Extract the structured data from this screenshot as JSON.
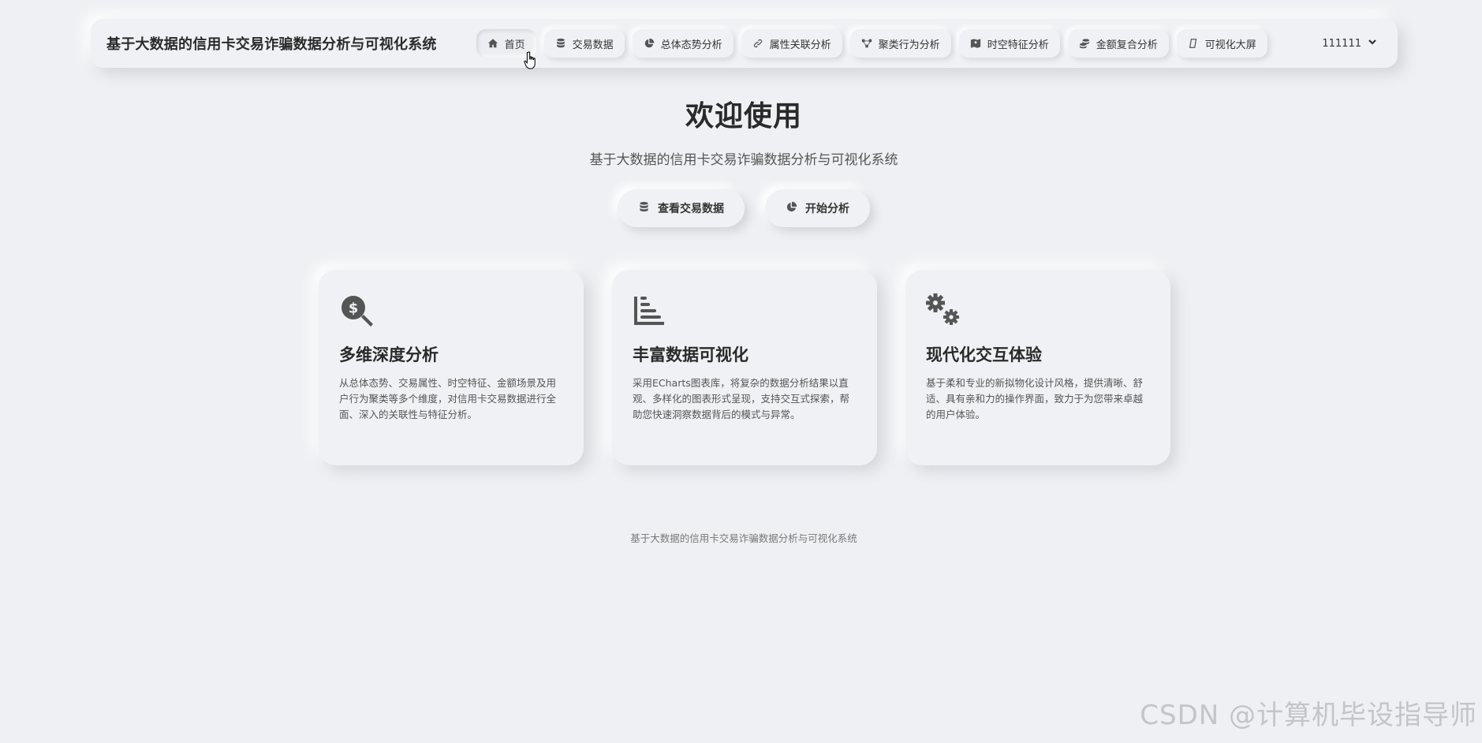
{
  "header": {
    "brand": "基于大数据的信用卡交易诈骗数据分析与可视化系统",
    "nav": [
      {
        "label": "首页",
        "icon": "home-icon",
        "active": true
      },
      {
        "label": "交易数据",
        "icon": "database-icon"
      },
      {
        "label": "总体态势分析",
        "icon": "pie-chart-icon"
      },
      {
        "label": "属性关联分析",
        "icon": "link-icon"
      },
      {
        "label": "聚类行为分析",
        "icon": "cluster-icon"
      },
      {
        "label": "时空特征分析",
        "icon": "map-icon"
      },
      {
        "label": "金额复合分析",
        "icon": "coins-icon"
      },
      {
        "label": "可视化大屏",
        "icon": "screen-icon"
      }
    ],
    "user": "111111"
  },
  "hero": {
    "title": "欢迎使用",
    "subtitle": "基于大数据的信用卡交易诈骗数据分析与可视化系统",
    "primary_button": "查看交易数据",
    "secondary_button": "开始分析"
  },
  "cards": [
    {
      "icon": "search-dollar-icon",
      "title": "多维深度分析",
      "desc": "从总体态势、交易属性、时空特征、金额场景及用户行为聚类等多个维度，对信用卡交易数据进行全面、深入的关联性与特征分析。"
    },
    {
      "icon": "bar-chart-icon",
      "title": "丰富数据可视化",
      "desc": "采用ECharts图表库，将复杂的数据分析结果以直观、多样化的图表形式呈现，支持交互式探索，帮助您快速洞察数据背后的模式与异常。"
    },
    {
      "icon": "gears-icon",
      "title": "现代化交互体验",
      "desc": "基于柔和专业的新拟物化设计风格，提供清晰、舒适、具有亲和力的操作界面，致力于为您带来卓越的用户体验。"
    }
  ],
  "footer": "基于大数据的信用卡交易诈骗数据分析与可视化系统",
  "watermark": "CSDN @计算机毕设指导师"
}
